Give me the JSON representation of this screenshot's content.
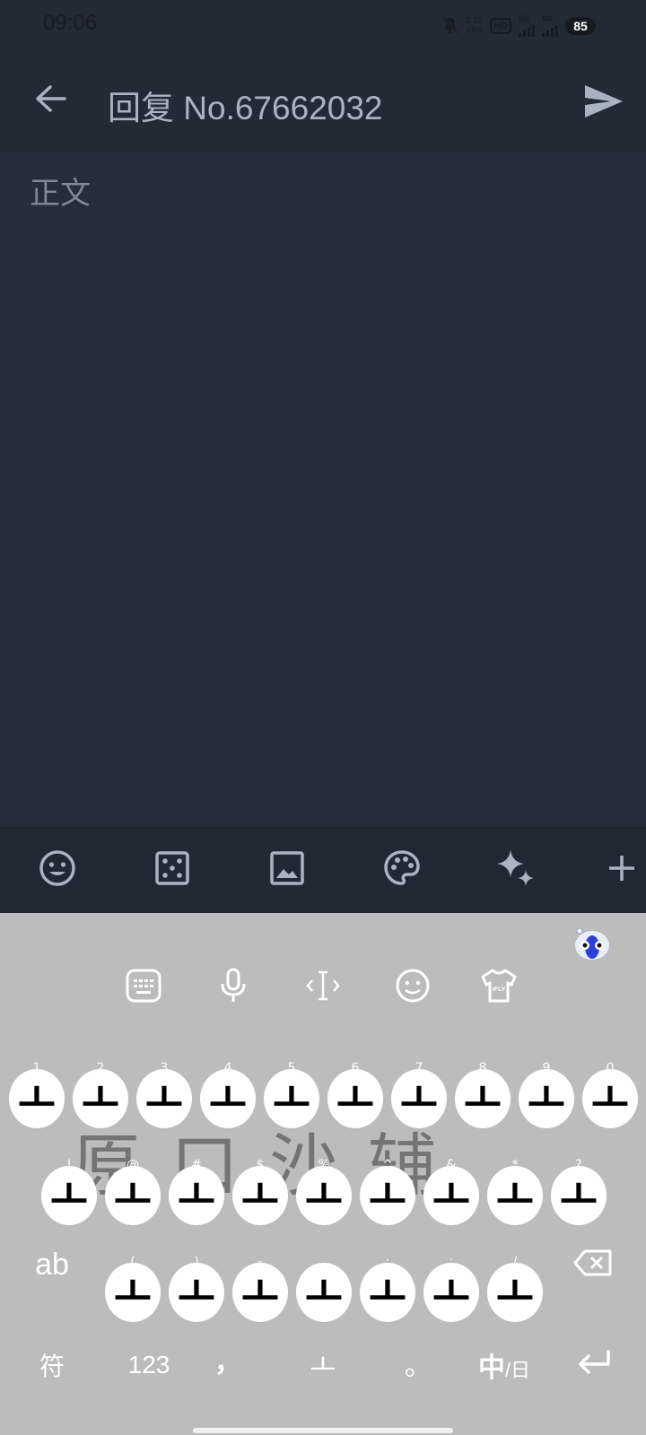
{
  "status_bar": {
    "time": "09:06",
    "net_speed_value": "2.70",
    "net_speed_unit": "KB/s",
    "hd_label": "HD",
    "signal_1": "5G",
    "signal_2": "5G",
    "battery": "85"
  },
  "header": {
    "title": "回复 No.67662032"
  },
  "compose": {
    "body_placeholder": "正文"
  },
  "keyboard": {
    "key_char": "ㅗ",
    "row1_hints": [
      "1",
      "2",
      "3",
      "4",
      "5",
      "6",
      "7",
      "8",
      "9",
      "0"
    ],
    "row2_hints": [
      "!",
      "@",
      "#",
      "$",
      "%",
      "^",
      "&",
      "*",
      "?"
    ],
    "row3_hints": [
      "(",
      ")",
      "-",
      "_",
      ":",
      ";",
      "/"
    ],
    "ab_label": "ab",
    "symbols_label": "符",
    "numbers_label": "123",
    "comma_label": "，",
    "space_label": "ㅗ",
    "period_label": "。",
    "lang_primary": "中",
    "lang_secondary": "/日",
    "watermark": "原口沙辅"
  },
  "icons": [
    "back-arrow-icon",
    "send-icon",
    "smiley-icon",
    "dice-icon",
    "image-icon",
    "palette-icon",
    "sparkle-icon",
    "plus-icon",
    "keyboard-icon",
    "microphone-icon",
    "cursor-icon",
    "emoji-icon",
    "shirt-icon",
    "backspace-icon",
    "enter-icon"
  ],
  "colors": {
    "background": "#252d3a",
    "header": "#222a36",
    "accent": "#a9b3c2",
    "keyboard": "#bcbcbc"
  }
}
